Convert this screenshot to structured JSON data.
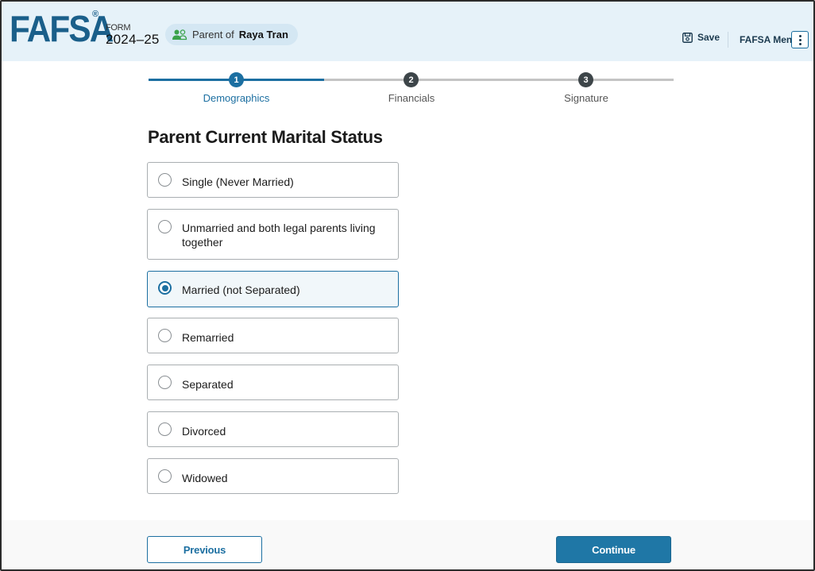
{
  "header": {
    "logo_text": "FAFSA",
    "logo_registered": "®",
    "form_label": "FORM",
    "form_year": "2024–25",
    "parent_prefix": "Parent of",
    "parent_name": "Raya Tran",
    "save_label": "Save",
    "menu_label": "FAFSA Menu",
    "icons": {
      "parent": "users-icon",
      "save": "save-icon",
      "menu": "kebab-menu-icon"
    }
  },
  "stepper": {
    "steps": [
      {
        "number": "1",
        "label": "Demographics",
        "state": "active"
      },
      {
        "number": "2",
        "label": "Financials",
        "state": "inactive"
      },
      {
        "number": "3",
        "label": "Signature",
        "state": "inactive"
      }
    ]
  },
  "main": {
    "title": "Parent Current Marital Status",
    "options": [
      {
        "label": "Single (Never Married)",
        "selected": false
      },
      {
        "label": "Unmarried and both legal parents living together",
        "selected": false
      },
      {
        "label": "Married (not Separated)",
        "selected": true
      },
      {
        "label": "Remarried",
        "selected": false
      },
      {
        "label": "Separated",
        "selected": false
      },
      {
        "label": "Divorced",
        "selected": false
      },
      {
        "label": "Widowed",
        "selected": false
      }
    ]
  },
  "footer": {
    "previous_label": "Previous",
    "continue_label": "Continue"
  },
  "colors": {
    "brand": "#1a5f8a",
    "accent": "#1c6fa1",
    "header_bg": "#e6f2f9",
    "pill_bg": "#d4e7f3",
    "user_icon": "#3aa24a",
    "inactive_step": "#3d4549"
  }
}
